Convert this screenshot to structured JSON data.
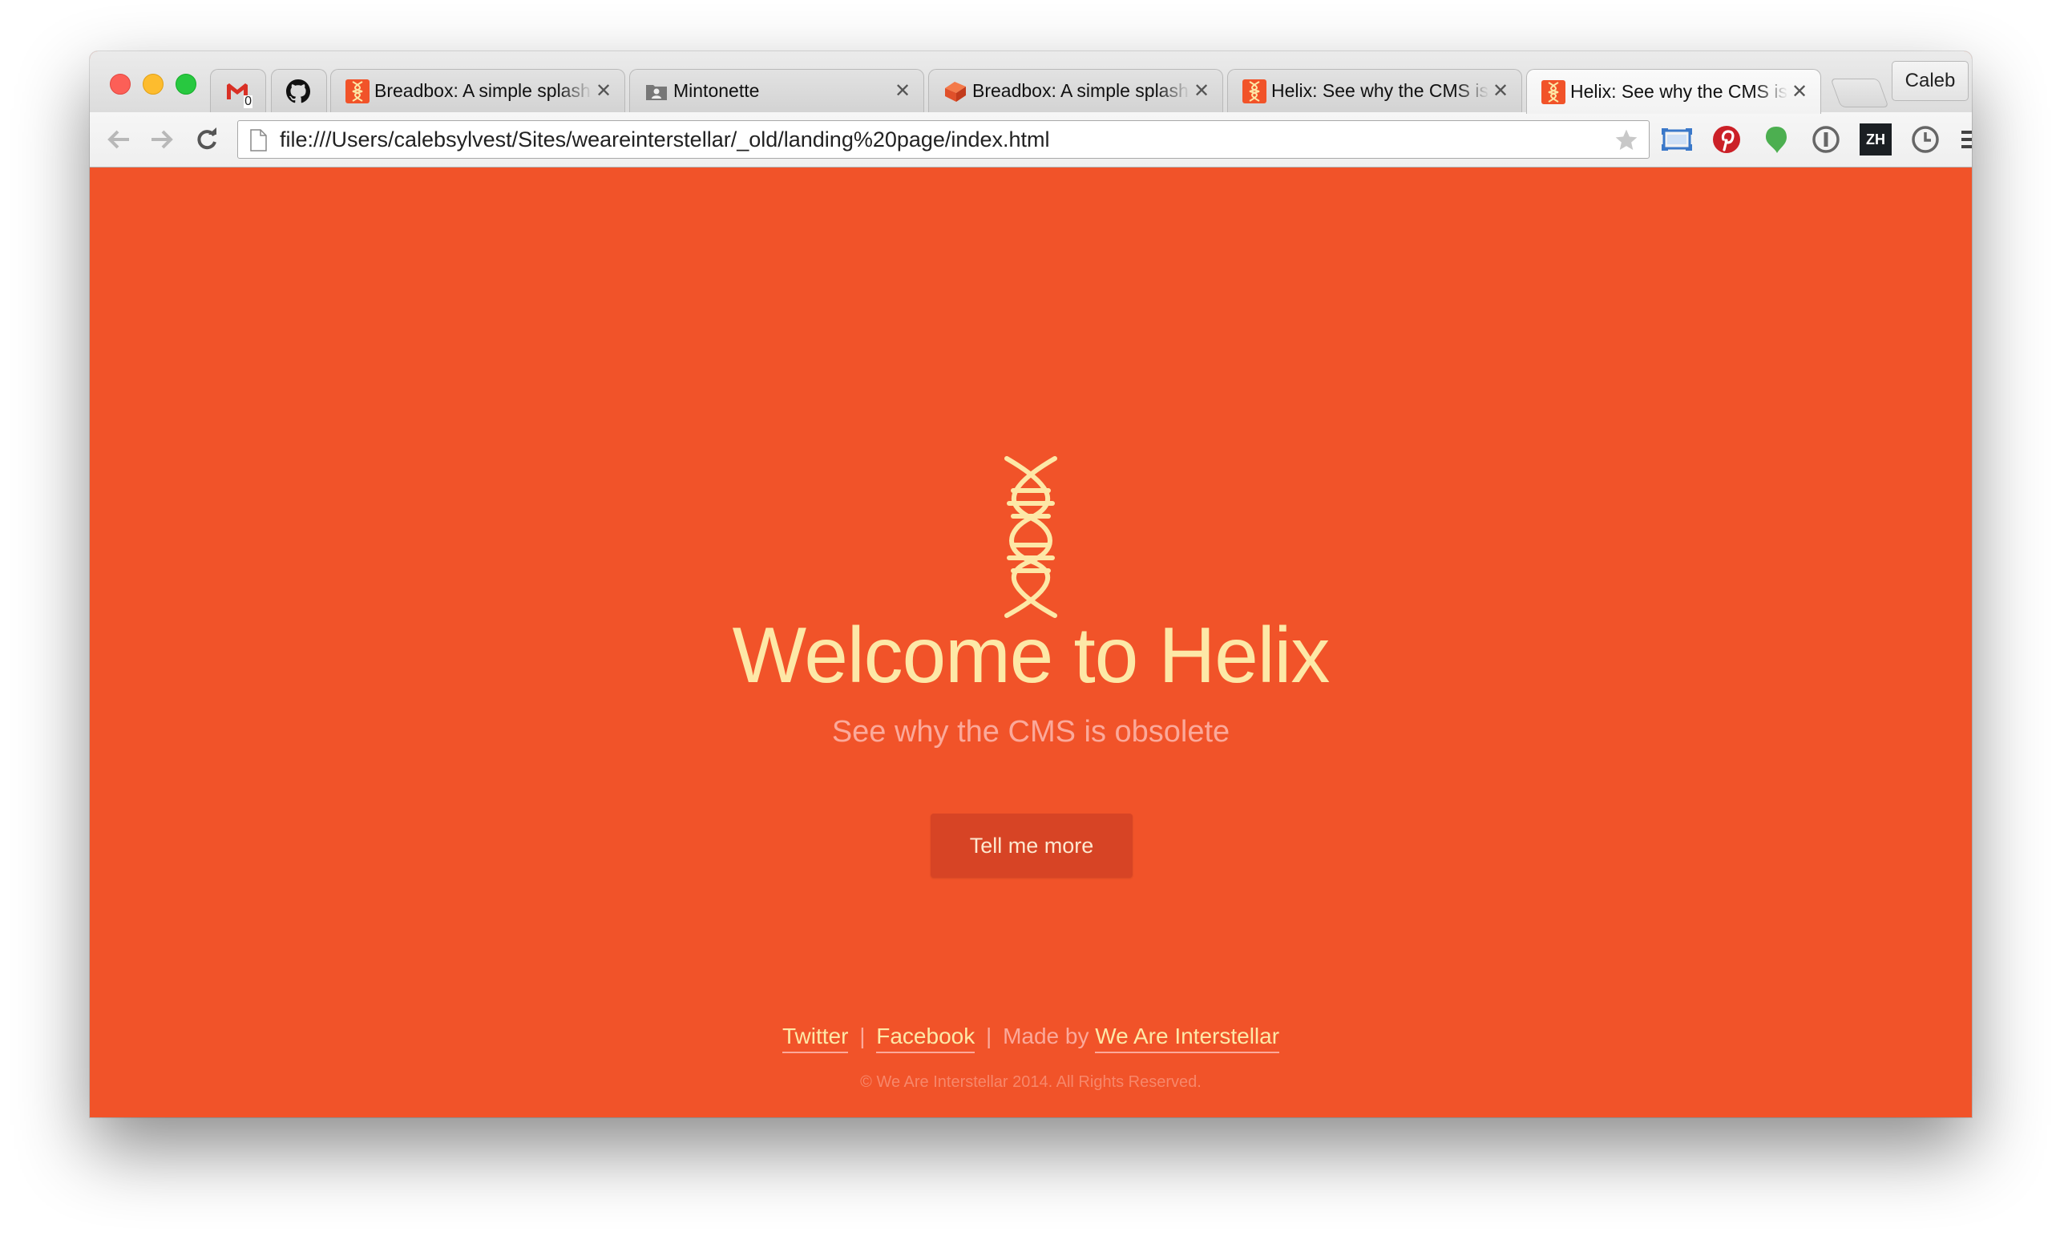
{
  "browser": {
    "tabs": [
      {
        "title": "",
        "favicon": "gmail-icon"
      },
      {
        "title": "",
        "favicon": "github-icon"
      },
      {
        "title": "Breadbox: A simple splash",
        "favicon": "helix-favicon"
      },
      {
        "title": "Mintonette",
        "favicon": "folder-user-icon"
      },
      {
        "title": "Breadbox: A simple splash",
        "favicon": "breadbox-favicon"
      },
      {
        "title": "Helix: See why the CMS is",
        "favicon": "helix-favicon"
      },
      {
        "title": "Helix: See why the CMS is",
        "favicon": "helix-favicon"
      }
    ],
    "gmail_badge": "0",
    "profile_name": "Caleb",
    "url": "file:///Users/calebsylvest/Sites/weareinterstellar/_old/landing%20page/index.html",
    "extensions": [
      "cast-icon",
      "pinterest-icon",
      "evernote-icon",
      "onepassword-icon",
      "zenhub-icon",
      "history-clock-icon",
      "menu-icon"
    ],
    "zenhub_label": "ZH"
  },
  "page": {
    "title": "Welcome to Helix",
    "subtitle": "See why the CMS is obsolete",
    "cta_label": "Tell me more",
    "footer": {
      "twitter": "Twitter",
      "separator": "|",
      "facebook": "Facebook",
      "made_by": "Made by",
      "company": "We Are Interstellar",
      "copyright": "© We Are Interstellar 2014. All Rights Reserved."
    }
  },
  "colors": {
    "page_background": "#f15329",
    "title_color": "#fde8a7",
    "subtitle_color": "#fba99a",
    "button_background": "#d74425"
  }
}
